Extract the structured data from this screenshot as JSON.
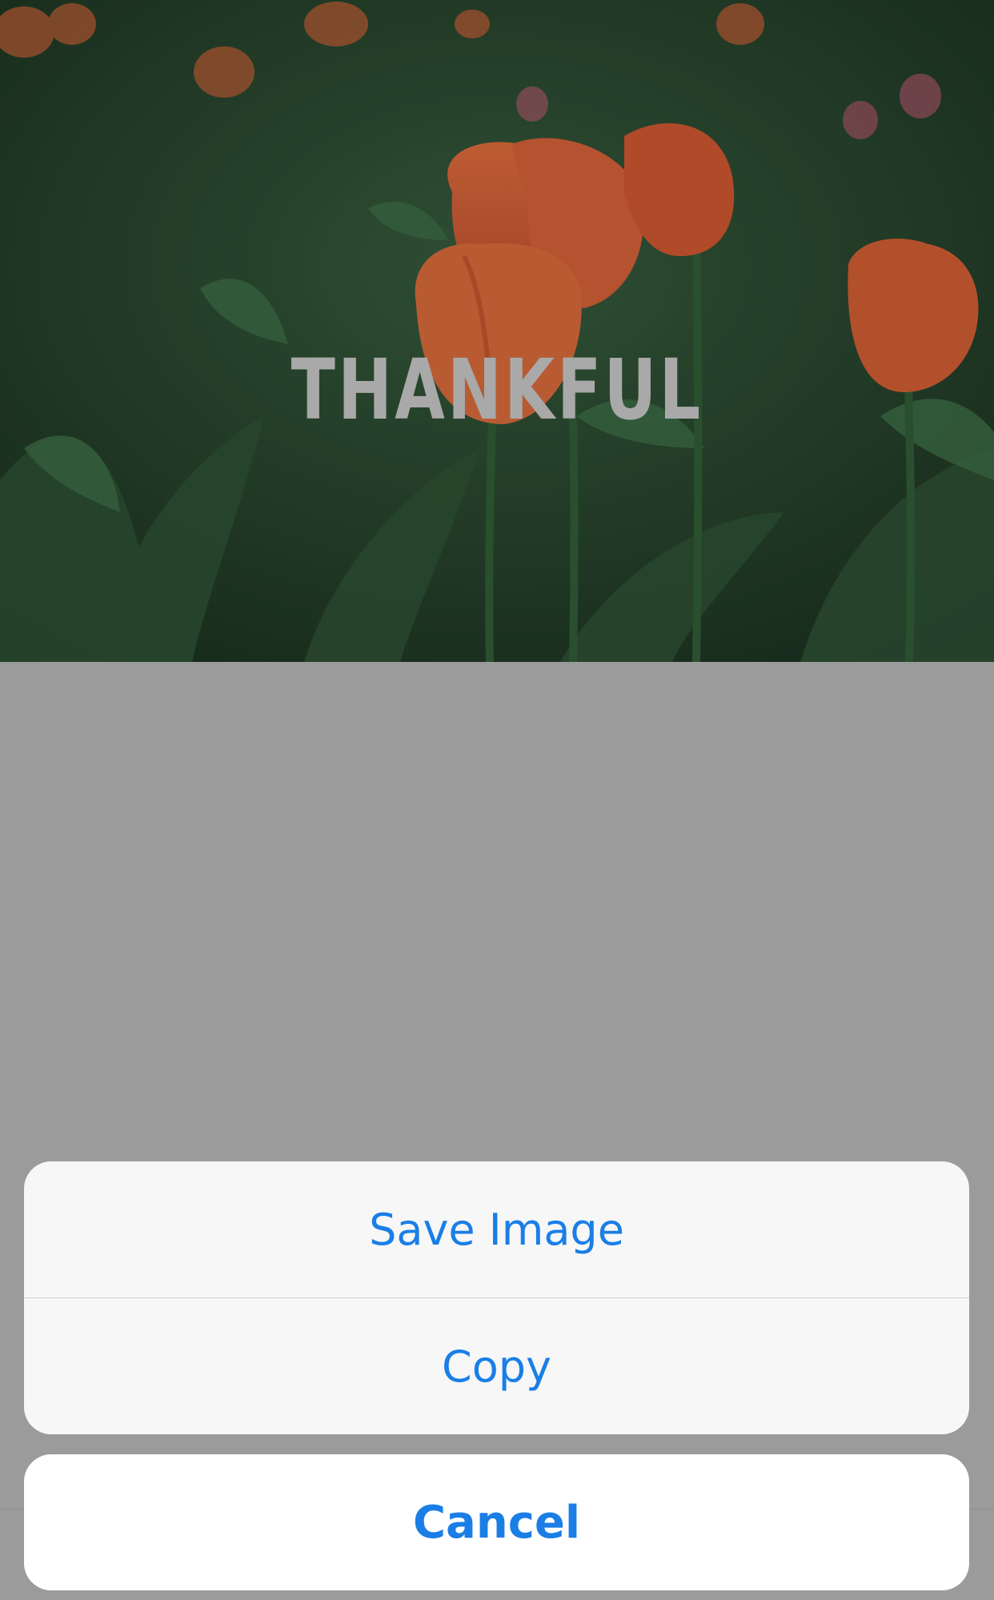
{
  "image": {
    "overlay_text": "THANKFUL"
  },
  "action_sheet": {
    "actions": [
      {
        "label": "Save Image"
      },
      {
        "label": "Copy"
      }
    ],
    "cancel_label": "Cancel"
  },
  "colors": {
    "action_blue": "#1a7ee6",
    "dim_background": "#9b9b9b",
    "sheet_background": "#f7f7f7"
  }
}
